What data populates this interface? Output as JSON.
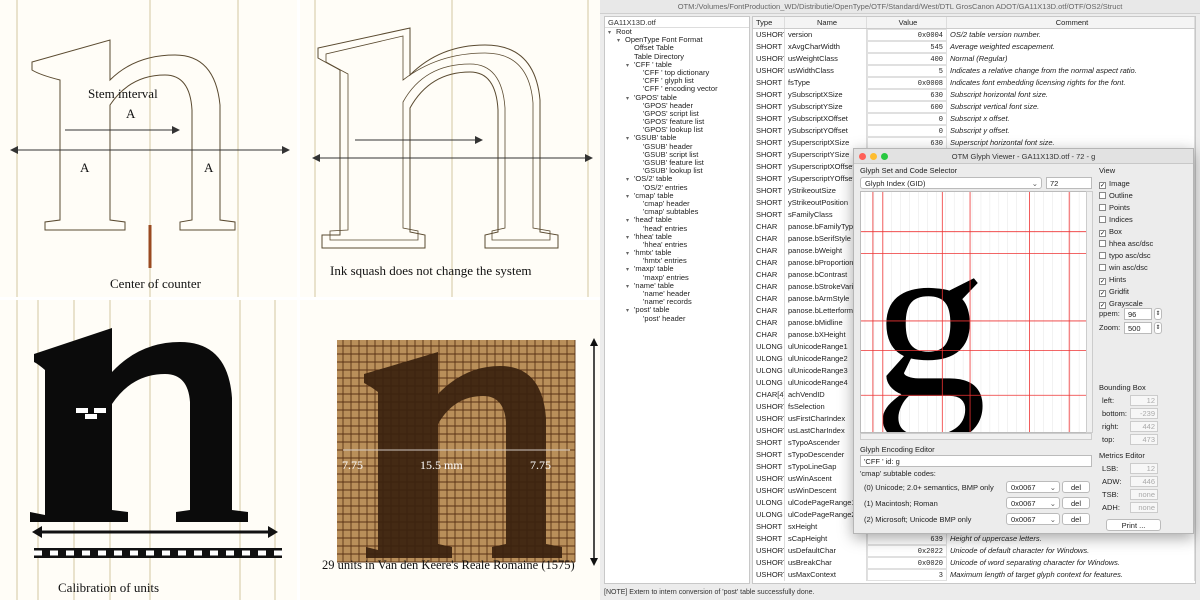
{
  "panels": {
    "top_left": {
      "label_stem": "Stem interval",
      "label_A_top": "A",
      "label_A_left": "A",
      "label_A_right": "A",
      "label_counter": "Center of counter"
    },
    "top_right": {
      "label": "Ink squash does not change the system"
    },
    "bottom_left": {
      "label": "Calibration of units"
    },
    "bottom_right": {
      "label": "29 units in Van den Keere's Reale Romaine (1575)",
      "m1": "7.75",
      "m2": "15.5 mm",
      "m3": "7.75"
    }
  },
  "app": {
    "title": "OTM:/Volumes/FontProduction_WD/Distributie/OpenType/OTF/Standard/West/DTL GrosCanon ADOT/GA11X13D.otf/OTF/OS2/Struct",
    "tree_header": "GA11X13D.otf",
    "tree": [
      {
        "t": "Root",
        "d": 0,
        "tw": "▾"
      },
      {
        "t": "OpenType Font Format",
        "d": 1,
        "tw": "▾"
      },
      {
        "t": "Offset Table",
        "d": 2,
        "tw": ""
      },
      {
        "t": "Table Directory",
        "d": 2,
        "tw": ""
      },
      {
        "t": "'CFF ' table",
        "d": 2,
        "tw": "▾"
      },
      {
        "t": "'CFF ' top dictionary",
        "d": 3,
        "tw": ""
      },
      {
        "t": "'CFF ' glyph list",
        "d": 3,
        "tw": ""
      },
      {
        "t": "'CFF ' encoding vector",
        "d": 3,
        "tw": ""
      },
      {
        "t": "'GPOS' table",
        "d": 2,
        "tw": "▾"
      },
      {
        "t": "'GPOS' header",
        "d": 3,
        "tw": ""
      },
      {
        "t": "'GPOS' script list",
        "d": 3,
        "tw": ""
      },
      {
        "t": "'GPOS' feature list",
        "d": 3,
        "tw": ""
      },
      {
        "t": "'GPOS' lookup list",
        "d": 3,
        "tw": ""
      },
      {
        "t": "'GSUB' table",
        "d": 2,
        "tw": "▾"
      },
      {
        "t": "'GSUB' header",
        "d": 3,
        "tw": ""
      },
      {
        "t": "'GSUB' script list",
        "d": 3,
        "tw": ""
      },
      {
        "t": "'GSUB' feature list",
        "d": 3,
        "tw": ""
      },
      {
        "t": "'GSUB' lookup list",
        "d": 3,
        "tw": ""
      },
      {
        "t": "'OS/2' table",
        "d": 2,
        "tw": "▾"
      },
      {
        "t": "'OS/2' entries",
        "d": 3,
        "tw": ""
      },
      {
        "t": "'cmap' table",
        "d": 2,
        "tw": "▾"
      },
      {
        "t": "'cmap' header",
        "d": 3,
        "tw": ""
      },
      {
        "t": "'cmap' subtables",
        "d": 3,
        "tw": ""
      },
      {
        "t": "'head' table",
        "d": 2,
        "tw": "▾"
      },
      {
        "t": "'head' entries",
        "d": 3,
        "tw": ""
      },
      {
        "t": "'hhea' table",
        "d": 2,
        "tw": "▾"
      },
      {
        "t": "'hhea' entries",
        "d": 3,
        "tw": ""
      },
      {
        "t": "'hmtx' table",
        "d": 2,
        "tw": "▾"
      },
      {
        "t": "'hmtx' entries",
        "d": 3,
        "tw": ""
      },
      {
        "t": "'maxp' table",
        "d": 2,
        "tw": "▾"
      },
      {
        "t": "'maxp' entries",
        "d": 3,
        "tw": ""
      },
      {
        "t": "'name' table",
        "d": 2,
        "tw": "▾"
      },
      {
        "t": "'name' header",
        "d": 3,
        "tw": ""
      },
      {
        "t": "'name' records",
        "d": 3,
        "tw": ""
      },
      {
        "t": "'post' table",
        "d": 2,
        "tw": "▾"
      },
      {
        "t": "'post' header",
        "d": 3,
        "tw": ""
      }
    ],
    "columns": [
      "Type",
      "Name",
      "Value",
      "Comment"
    ],
    "rows": [
      [
        "USHORT",
        "version",
        "0x0004",
        "OS/2 table version number."
      ],
      [
        "SHORT",
        "xAvgCharWidth",
        "545",
        "Average weighted escapement."
      ],
      [
        "USHORT",
        "usWeightClass",
        "400",
        "Normal (Regular)"
      ],
      [
        "USHORT",
        "usWidthClass",
        "5",
        "Indicates a relative change from the normal aspect ratio."
      ],
      [
        "SHORT",
        "fsType",
        "0x0008",
        "Indicates font embedding licensing rights for the font."
      ],
      [
        "SHORT",
        "ySubscriptXSize",
        "630",
        "Subscript horizontal font size."
      ],
      [
        "SHORT",
        "ySubscriptYSize",
        "600",
        "Subscript vertical font size."
      ],
      [
        "SHORT",
        "ySubscriptXOffset",
        "0",
        "Subscript x offset."
      ],
      [
        "SHORT",
        "ySubscriptYOffset",
        "0",
        "Subscript y offset."
      ],
      [
        "SHORT",
        "ySuperscriptXSize",
        "630",
        "Superscript horizontal font size."
      ],
      [
        "SHORT",
        "ySuperscriptYSize",
        "",
        ""
      ],
      [
        "SHORT",
        "ySuperscriptXOffset",
        "",
        ""
      ],
      [
        "SHORT",
        "ySuperscriptYOffset",
        "",
        ""
      ],
      [
        "SHORT",
        "yStrikeoutSize",
        "",
        ""
      ],
      [
        "SHORT",
        "yStrikeoutPosition",
        "",
        ""
      ],
      [
        "SHORT",
        "sFamilyClass",
        "",
        ""
      ],
      [
        "CHAR",
        "panose.bFamilyType",
        "",
        ""
      ],
      [
        "CHAR",
        "panose.bSerifStyle",
        "",
        ""
      ],
      [
        "CHAR",
        "panose.bWeight",
        "",
        ""
      ],
      [
        "CHAR",
        "panose.bProportion",
        "",
        ""
      ],
      [
        "CHAR",
        "panose.bContrast",
        "",
        ""
      ],
      [
        "CHAR",
        "panose.bStrokeVariation",
        "",
        ""
      ],
      [
        "CHAR",
        "panose.bArmStyle",
        "",
        ""
      ],
      [
        "CHAR",
        "panose.bLetterform",
        "",
        ""
      ],
      [
        "CHAR",
        "panose.bMidline",
        "",
        ""
      ],
      [
        "CHAR",
        "panose.bXHeight",
        "",
        ""
      ],
      [
        "ULONG",
        "ulUnicodeRange1",
        "",
        ""
      ],
      [
        "ULONG",
        "ulUnicodeRange2",
        "",
        ""
      ],
      [
        "ULONG",
        "ulUnicodeRange3",
        "",
        ""
      ],
      [
        "ULONG",
        "ulUnicodeRange4",
        "",
        ""
      ],
      [
        "CHAR[4]",
        "achVendID",
        "",
        ""
      ],
      [
        "USHORT",
        "fsSelection",
        "",
        ""
      ],
      [
        "USHORT",
        "usFirstCharIndex",
        "",
        ""
      ],
      [
        "USHORT",
        "usLastCharIndex",
        "",
        ""
      ],
      [
        "SHORT",
        "sTypoAscender",
        "",
        ""
      ],
      [
        "SHORT",
        "sTypoDescender",
        "",
        ""
      ],
      [
        "SHORT",
        "sTypoLineGap",
        "",
        ""
      ],
      [
        "USHORT",
        "usWinAscent",
        "",
        ""
      ],
      [
        "USHORT",
        "usWinDescent",
        "",
        ""
      ],
      [
        "ULONG",
        "ulCodePageRange1",
        "",
        ""
      ],
      [
        "ULONG",
        "ulCodePageRange2",
        "",
        ""
      ],
      [
        "SHORT",
        "sxHeight",
        "",
        ""
      ],
      [
        "SHORT",
        "sCapHeight",
        "639",
        "Height of uppercase letters."
      ],
      [
        "USHORT",
        "usDefaultChar",
        "0x2022",
        "Unicode of default character for Windows."
      ],
      [
        "USHORT",
        "usBreakChar",
        "0x0020",
        "Unicode of word separating character for Windows."
      ],
      [
        "USHORT",
        "usMaxContext",
        "3",
        "Maximum length of target glyph context for features."
      ]
    ],
    "status": "[NOTE] Extern to intern conversion of 'post' table successfully done."
  },
  "viewer": {
    "title": "OTM Glyph Viewer - GA11X13D.otf - 72 - g",
    "section_selector": "Glyph Set and Code Selector",
    "glyph_set": "Glyph Index (GID)",
    "code": "72",
    "glyph_char": "g",
    "view_label": "View",
    "options": [
      {
        "label": "Image",
        "checked": true
      },
      {
        "label": "Outline",
        "checked": false
      },
      {
        "label": "Points",
        "checked": false
      },
      {
        "label": "Indices",
        "checked": false
      },
      {
        "label": "Box",
        "checked": true
      },
      {
        "label": "hhea asc/dsc",
        "checked": false
      },
      {
        "label": "typo asc/dsc",
        "checked": false
      },
      {
        "label": "win asc/dsc",
        "checked": false
      },
      {
        "label": "Hints",
        "checked": true
      },
      {
        "label": "Gridfit",
        "checked": true
      },
      {
        "label": "Grayscale",
        "checked": true
      }
    ],
    "ppem_label": "ppem:",
    "ppem": "96",
    "zoom_label": "Zoom:",
    "zoom": "500",
    "bbox_label": "Bounding Box",
    "bbox": [
      {
        "k": "left:",
        "v": "12"
      },
      {
        "k": "bottom:",
        "v": "-239"
      },
      {
        "k": "right:",
        "v": "442"
      },
      {
        "k": "top:",
        "v": "473"
      }
    ],
    "enc_label": "Glyph Encoding Editor",
    "cff_id": "'CFF ' id: g",
    "subtable_label": "'cmap' subtable codes:",
    "enc_rows": [
      {
        "label": "(0) Unicode; 2.0+ semantics, BMP only",
        "code": "0x0067",
        "del": "del"
      },
      {
        "label": "(1) Macintosh; Roman",
        "code": "0x0067",
        "del": "del"
      },
      {
        "label": "(2) Microsoft; Unicode BMP only",
        "code": "0x0067",
        "del": "del"
      }
    ],
    "metrics_label": "Metrics Editor",
    "metrics": [
      {
        "k": "LSB:",
        "v": "12"
      },
      {
        "k": "ADW:",
        "v": "446"
      },
      {
        "k": "TSB:",
        "v": "none"
      },
      {
        "k": "ADH:",
        "v": "none"
      }
    ],
    "print": "Print ..."
  }
}
